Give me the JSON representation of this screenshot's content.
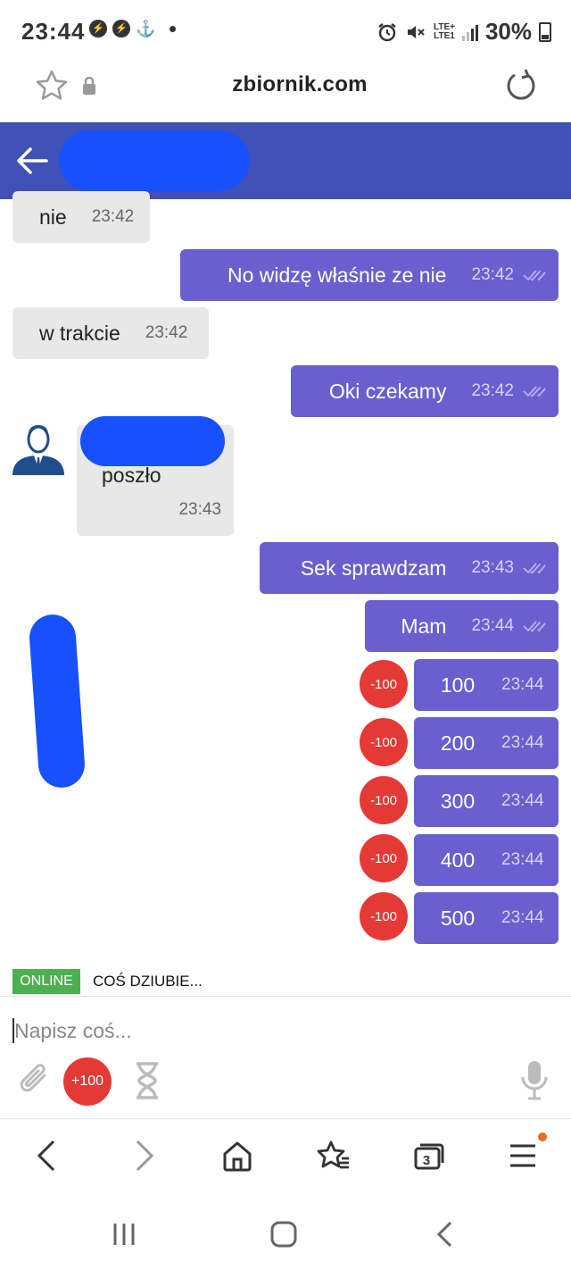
{
  "status_bar": {
    "time": "23:44",
    "battery": "30%",
    "lte_top": "LTE+",
    "lte_bottom": "LTE1"
  },
  "browser": {
    "domain": "zbiornik.com"
  },
  "chat": {
    "messages_top": [
      {
        "dir": "in",
        "text": "nie",
        "time": "23:42"
      },
      {
        "dir": "out",
        "text": "No widzę właśnie ze nie",
        "time": "23:42"
      },
      {
        "dir": "in",
        "text": "w trakcie",
        "time": "23:42"
      },
      {
        "dir": "out",
        "text": "Oki czekamy",
        "time": "23:42"
      }
    ],
    "avatar_message": {
      "text": "poszło",
      "time": "23:43"
    },
    "messages_bottom": [
      {
        "dir": "out",
        "text": "Sek sprawdzam",
        "time": "23:43"
      },
      {
        "dir": "out",
        "text": "Mam",
        "time": "23:44"
      }
    ],
    "amount_badge": "-100",
    "amounts": [
      {
        "text": "100",
        "time": "23:44"
      },
      {
        "text": "200",
        "time": "23:44"
      },
      {
        "text": "300",
        "time": "23:44"
      },
      {
        "text": "400",
        "time": "23:44"
      },
      {
        "text": "500",
        "time": "23:44"
      }
    ]
  },
  "presence": {
    "online": "ONLINE",
    "typing": "COŚ DZIUBIE..."
  },
  "composer": {
    "placeholder": "Napisz coś...",
    "tip_label": "+100"
  },
  "browser_nav": {
    "tab_count": "3"
  },
  "colors": {
    "header": "#3f51b5",
    "outgoing_bubble": "#6a5fcf",
    "incoming_bubble": "#e8e8e8",
    "badge_red": "#e53935",
    "online_green": "#4caf50",
    "redaction_blue": "#1650ff"
  }
}
